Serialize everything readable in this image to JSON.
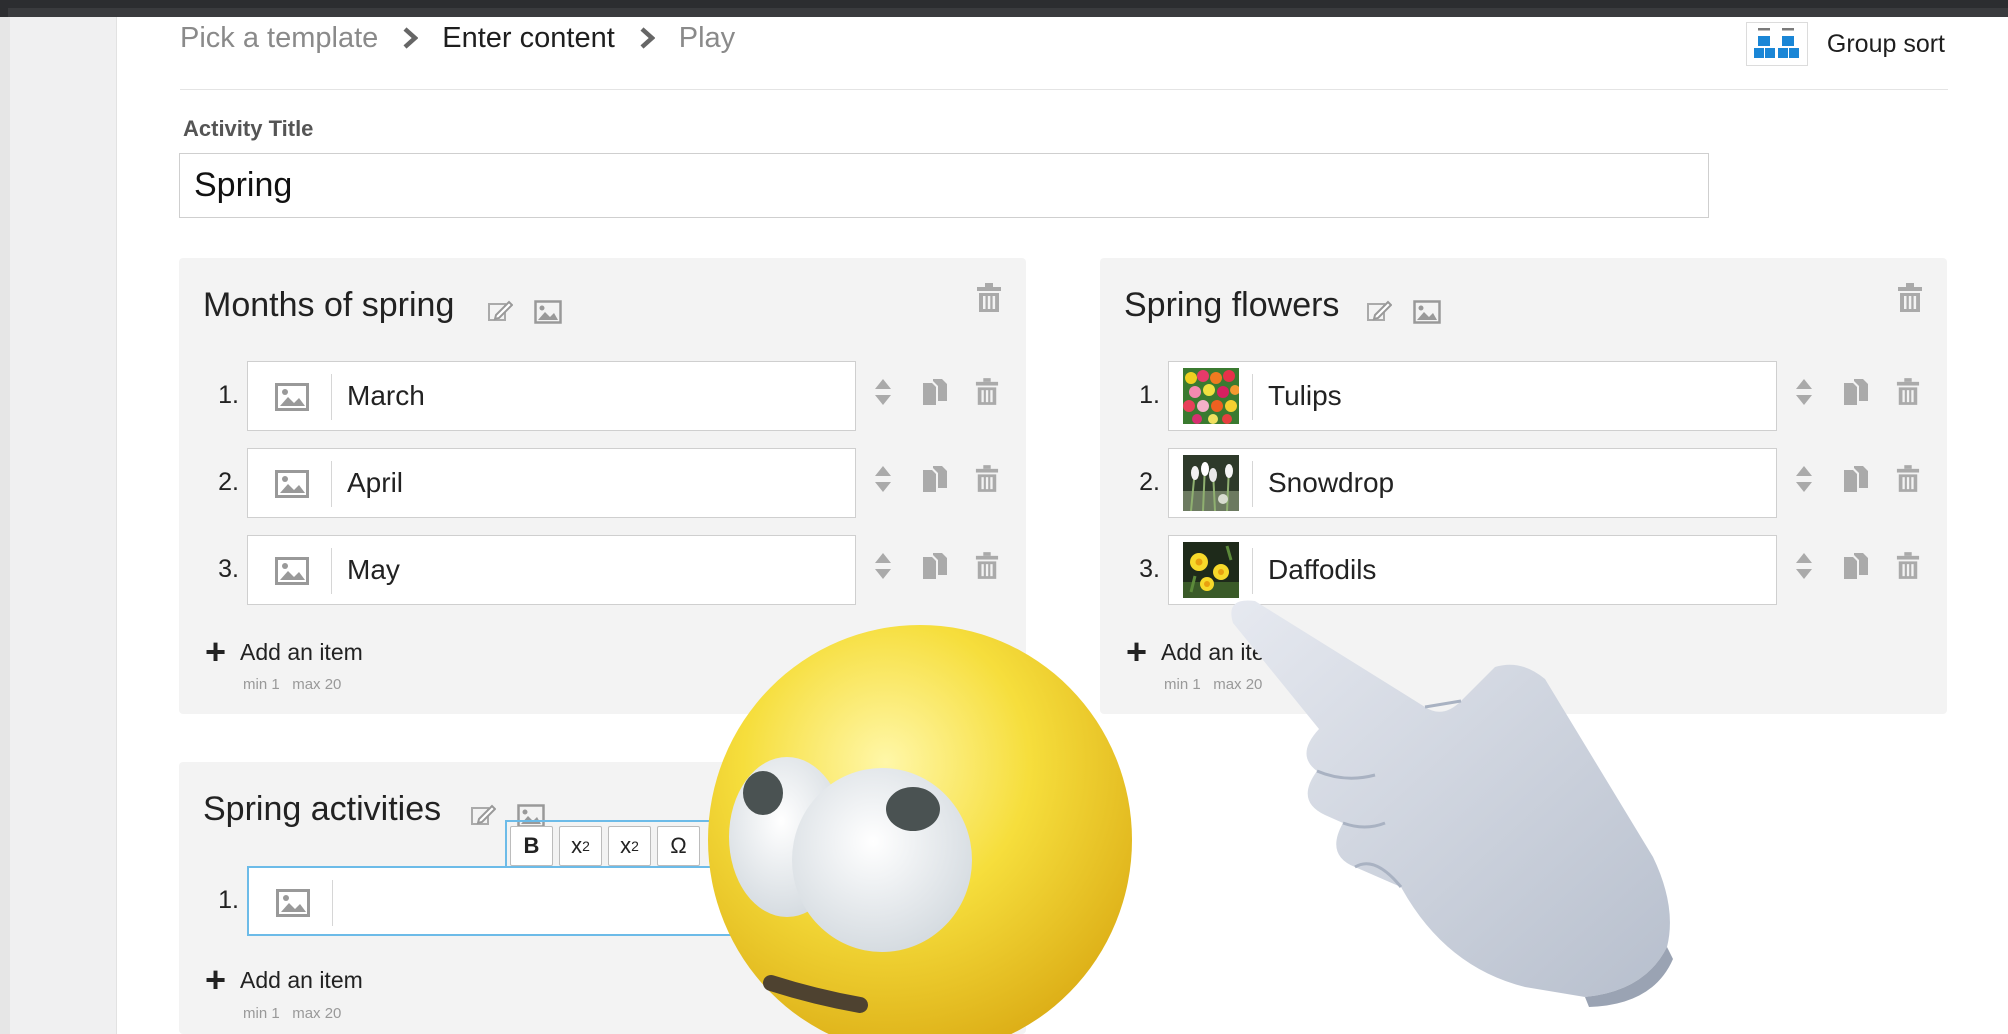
{
  "breadcrumb": {
    "steps": [
      "Pick a template",
      "Enter content",
      "Play"
    ],
    "active_index": 1
  },
  "template": {
    "name": "Group sort",
    "icon": "group-sort-icon"
  },
  "activity": {
    "title_label": "Activity Title",
    "title_value": "Spring"
  },
  "groups": [
    {
      "title": "Months of spring",
      "items": [
        {
          "number": "1.",
          "text": "March",
          "image": "placeholder"
        },
        {
          "number": "2.",
          "text": "April",
          "image": "placeholder"
        },
        {
          "number": "3.",
          "text": "May",
          "image": "placeholder"
        }
      ],
      "add_label": "Add an item",
      "min_label": "min 1",
      "max_label": "max 20"
    },
    {
      "title": "Spring flowers",
      "items": [
        {
          "number": "1.",
          "text": "Tulips",
          "image": "tulips-photo"
        },
        {
          "number": "2.",
          "text": "Snowdrop",
          "image": "snowdrop-photo"
        },
        {
          "number": "3.",
          "text": "Daffodils",
          "image": "daffodils-photo"
        }
      ],
      "add_label": "Add an item",
      "min_label": "min 1",
      "max_label": "max 20"
    },
    {
      "title": "Spring activities",
      "items": [
        {
          "number": "1.",
          "text": "",
          "image": "placeholder"
        }
      ],
      "add_label": "Add an item",
      "min_label": "min 1",
      "max_label": "max 20"
    }
  ],
  "format_toolbar": {
    "bold": "B",
    "superscript_base": "x",
    "superscript_mark": "2",
    "subscript_base": "x",
    "subscript_mark": "2",
    "special_char": "Ω"
  },
  "overlays": [
    "eye-roll-emoji",
    "pointing-hand"
  ],
  "colors": {
    "accent": "#6cbbe8",
    "panel": "#f3f3f3",
    "icon_blue": "#1a86d6",
    "emoji_yellow": "#f3cc20"
  }
}
